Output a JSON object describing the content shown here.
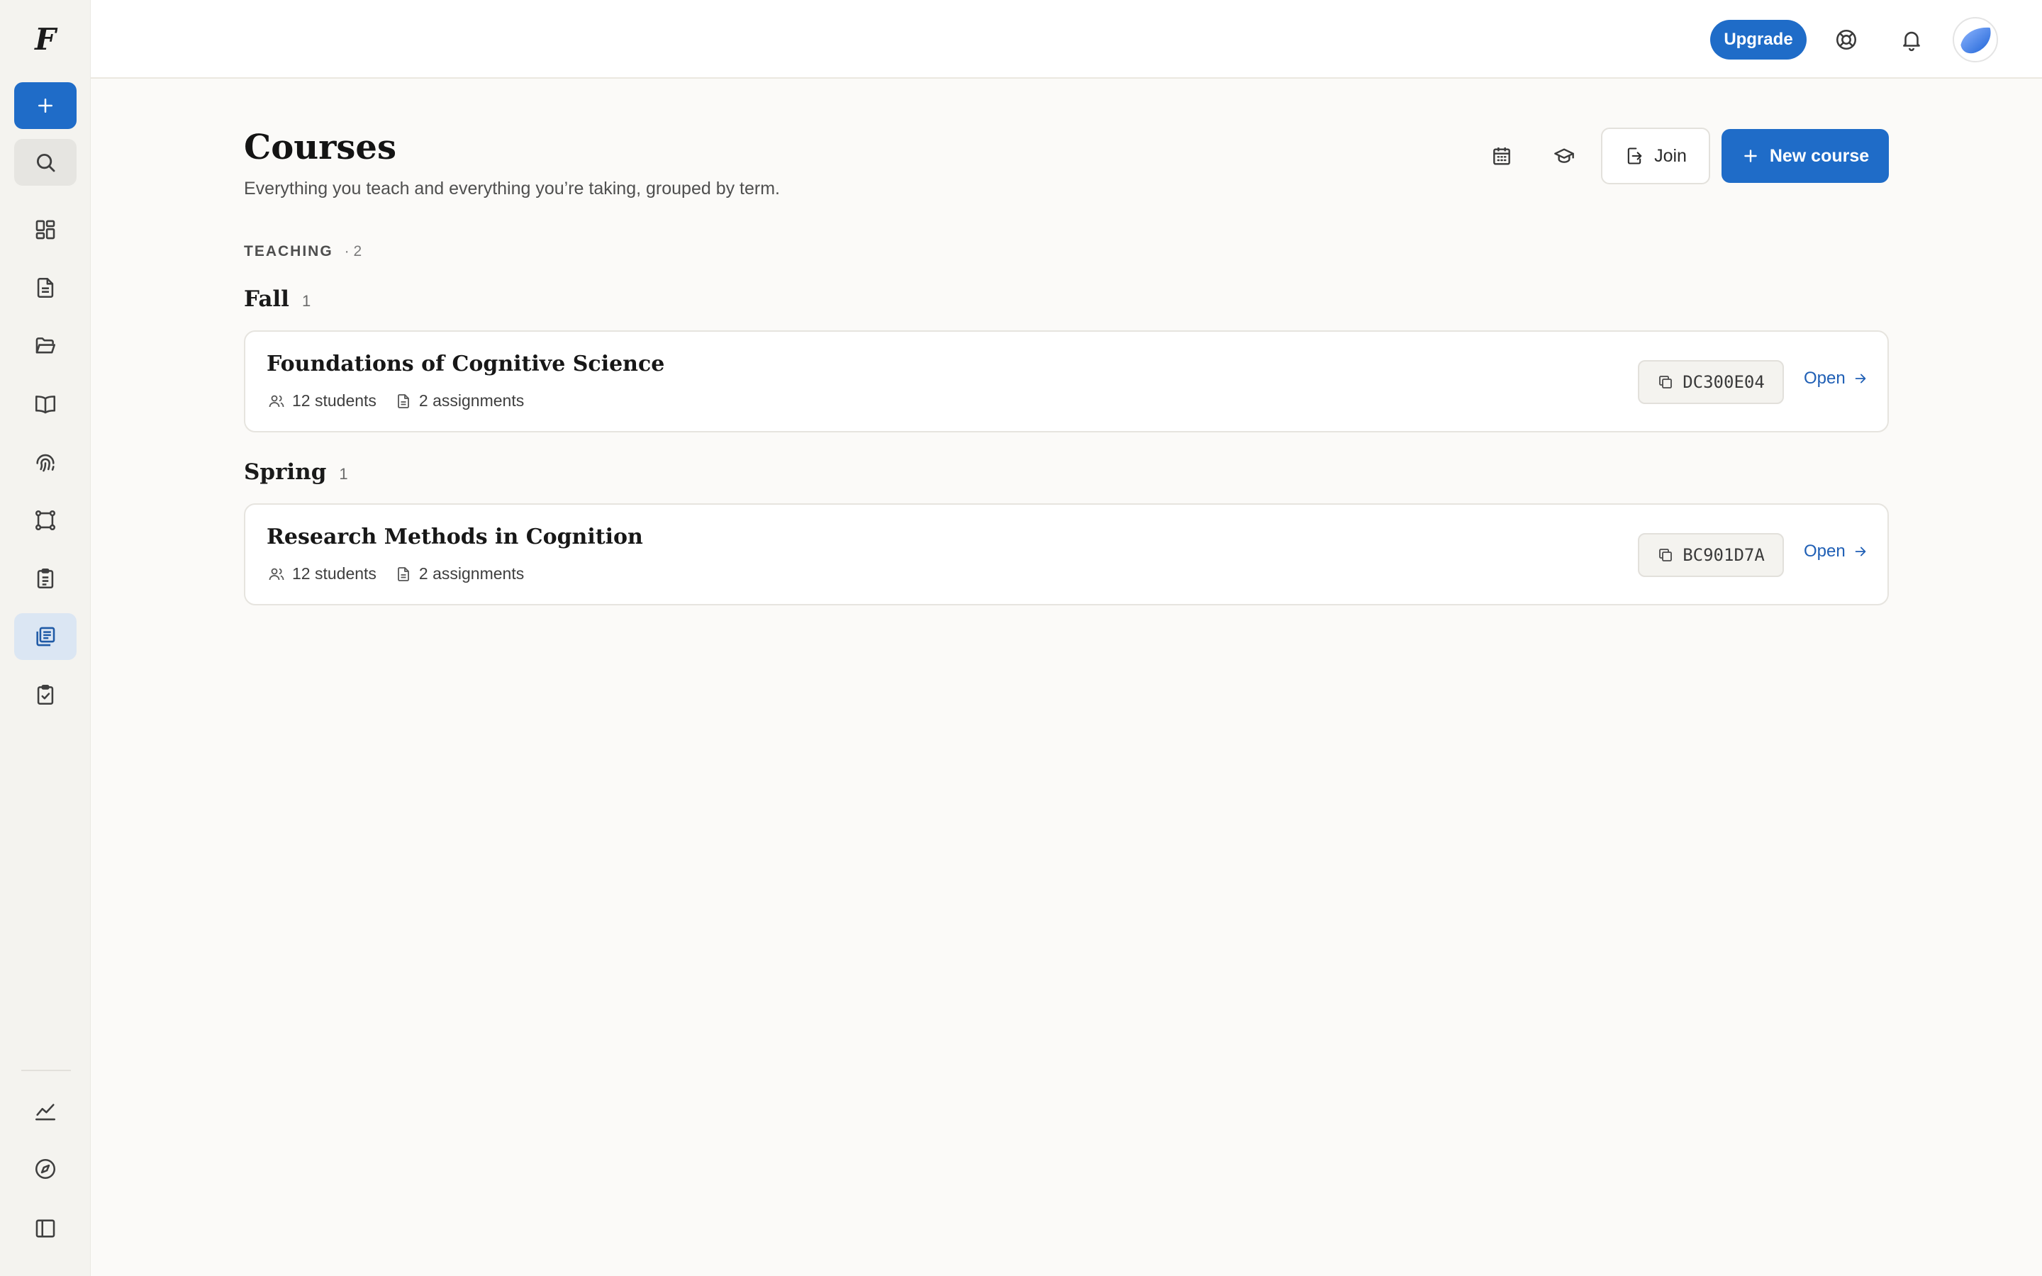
{
  "app": {
    "logo": "F"
  },
  "sidebar": {
    "items": [
      {
        "name": "new",
        "icon": "plus-icon"
      },
      {
        "name": "search",
        "icon": "search-icon"
      },
      {
        "name": "dashboard",
        "icon": "dashboard-icon"
      },
      {
        "name": "documents",
        "icon": "document-icon"
      },
      {
        "name": "folders",
        "icon": "folder-open-icon"
      },
      {
        "name": "library",
        "icon": "book-open-icon"
      },
      {
        "name": "fingerprint",
        "icon": "fingerprint-icon"
      },
      {
        "name": "workflow",
        "icon": "route-icon"
      },
      {
        "name": "tasks",
        "icon": "clipboard-list-icon"
      },
      {
        "name": "courses",
        "icon": "courses-icon",
        "active": true
      },
      {
        "name": "assignments",
        "icon": "clipboard-check-icon"
      },
      {
        "name": "analytics",
        "icon": "chart-line-icon"
      },
      {
        "name": "explore",
        "icon": "compass-icon"
      },
      {
        "name": "toggle-sidebar",
        "icon": "sidebar-toggle-icon"
      }
    ]
  },
  "topbar": {
    "upgrade_label": "Upgrade",
    "help_icon": "lifebuoy-icon",
    "notifications_icon": "bell-icon"
  },
  "header": {
    "title": "Courses",
    "subtitle": "Everything you teach and everything you’re taking, grouped by term.",
    "join_label": "Join",
    "new_course_label": "New course"
  },
  "section": {
    "label": "TEACHING",
    "count": "· 2"
  },
  "terms": [
    {
      "name": "Fall",
      "count": "1",
      "course": {
        "title": "Foundations of Cognitive Science",
        "students": "12 students",
        "assignments": "2 assignments",
        "code": "DC300E04",
        "open_label": "Open"
      }
    },
    {
      "name": "Spring",
      "count": "1",
      "course": {
        "title": "Research Methods in Cognition",
        "students": "12 students",
        "assignments": "2 assignments",
        "code": "BC901D7A",
        "open_label": "Open"
      }
    }
  ],
  "colors": {
    "accent": "#1f6cc8",
    "sidebar_bg": "#f4f3ef",
    "page_bg": "#fbfaf8",
    "active_item_bg": "#dbe6f3",
    "link": "#1f5fb5"
  }
}
